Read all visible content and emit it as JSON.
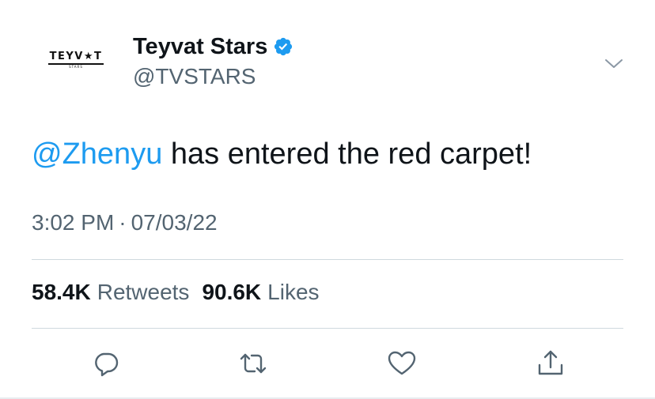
{
  "author": {
    "avatar_wordmark": "TEYV★T",
    "avatar_subtext": "STARS",
    "display_name": "Teyvat Stars",
    "handle": "@TVSTARS",
    "verified": true
  },
  "tweet": {
    "mention": "@Zhenyu",
    "text": " has entered the red carpet!",
    "time": "3:02 PM",
    "separator": "·",
    "date": "07/03/22"
  },
  "stats": {
    "retweets_count": "58.4K",
    "retweets_label": "Retweets",
    "likes_count": "90.6K",
    "likes_label": "Likes"
  },
  "icons": {
    "verified": "verified-badge-icon",
    "menu": "chevron-down-icon",
    "reply": "reply-icon",
    "retweet": "retweet-icon",
    "like": "heart-icon",
    "share": "share-icon"
  },
  "colors": {
    "accent": "#1d9bf0",
    "text": "#0f1419",
    "secondary_text": "#536471",
    "divider": "#cfd9de"
  }
}
